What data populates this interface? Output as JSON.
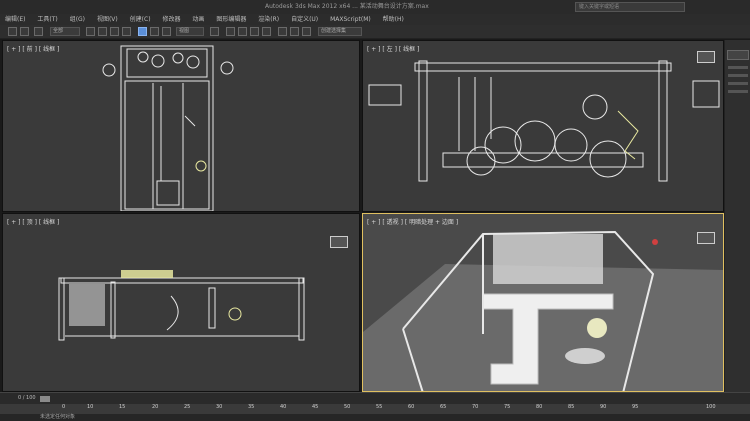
{
  "app": {
    "title": "Autodesk 3ds Max 2012 x64    ... 某活动舞台设计方案.max",
    "search_placeholder": "键入关键字或短语"
  },
  "menu": [
    "编辑(E)",
    "工具(T)",
    "组(G)",
    "视图(V)",
    "创建(C)",
    "修改器",
    "动画",
    "图形编辑器",
    "渲染(R)",
    "自定义(U)",
    "MAXScript(M)",
    "帮助(H)"
  ],
  "toolbar": {
    "selection_filter": "全部",
    "view_mode": "视图",
    "named_set": "创建选择集"
  },
  "viewports": {
    "top_left": {
      "label": "[ + ] [ 前 ] [ 线框 ]"
    },
    "top_right": {
      "label": "[ + ] [ 左 ] [ 线框 ]"
    },
    "bottom_left": {
      "label": "[ + ] [ 顶 ] [ 线框 ]"
    },
    "bottom_right": {
      "label": "[ + ] [ 透视 ] [ 明暗处理 + 边面 ]"
    }
  },
  "timeline": {
    "frame_display": "0 / 100",
    "ticks": [
      "0",
      "10",
      "15",
      "20",
      "25",
      "30",
      "35",
      "40",
      "45",
      "50",
      "55",
      "60",
      "65",
      "70",
      "75",
      "80",
      "85",
      "90",
      "95",
      "100"
    ]
  },
  "status": {
    "text": "未选定任何对象"
  },
  "colors": {
    "viewport_bg": "#3a3a3a",
    "active_border": "#e0c060",
    "wire": "#e8e8e8",
    "highlight": "#e8e8a0"
  }
}
